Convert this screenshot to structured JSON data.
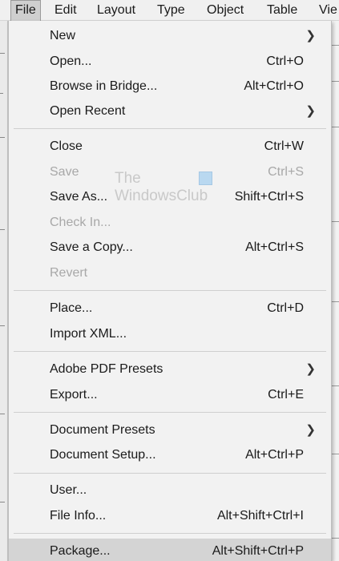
{
  "menubar": {
    "items": [
      "File",
      "Edit",
      "Layout",
      "Type",
      "Object",
      "Table",
      "Vie"
    ]
  },
  "watermark": {
    "line1": "The",
    "line2": "WindowsClub"
  },
  "menu": {
    "items": [
      {
        "label": "New",
        "shortcut": "",
        "submenu": true,
        "disabled": false
      },
      {
        "label": "Open...",
        "shortcut": "Ctrl+O",
        "submenu": false,
        "disabled": false
      },
      {
        "label": "Browse in Bridge...",
        "shortcut": "Alt+Ctrl+O",
        "submenu": false,
        "disabled": false
      },
      {
        "label": "Open Recent",
        "shortcut": "",
        "submenu": true,
        "disabled": false
      },
      {
        "label": "Close",
        "shortcut": "Ctrl+W",
        "submenu": false,
        "disabled": false
      },
      {
        "label": "Save",
        "shortcut": "Ctrl+S",
        "submenu": false,
        "disabled": true
      },
      {
        "label": "Save As...",
        "shortcut": "Shift+Ctrl+S",
        "submenu": false,
        "disabled": false
      },
      {
        "label": "Check In...",
        "shortcut": "",
        "submenu": false,
        "disabled": true
      },
      {
        "label": "Save a Copy...",
        "shortcut": "Alt+Ctrl+S",
        "submenu": false,
        "disabled": false
      },
      {
        "label": "Revert",
        "shortcut": "",
        "submenu": false,
        "disabled": true
      },
      {
        "label": "Place...",
        "shortcut": "Ctrl+D",
        "submenu": false,
        "disabled": false
      },
      {
        "label": "Import XML...",
        "shortcut": "",
        "submenu": false,
        "disabled": false
      },
      {
        "label": "Adobe PDF Presets",
        "shortcut": "",
        "submenu": true,
        "disabled": false
      },
      {
        "label": "Export...",
        "shortcut": "Ctrl+E",
        "submenu": false,
        "disabled": false
      },
      {
        "label": "Document Presets",
        "shortcut": "",
        "submenu": true,
        "disabled": false
      },
      {
        "label": "Document Setup...",
        "shortcut": "Alt+Ctrl+P",
        "submenu": false,
        "disabled": false
      },
      {
        "label": "User...",
        "shortcut": "",
        "submenu": false,
        "disabled": false
      },
      {
        "label": "File Info...",
        "shortcut": "Alt+Shift+Ctrl+I",
        "submenu": false,
        "disabled": false
      },
      {
        "label": "Package...",
        "shortcut": "Alt+Shift+Ctrl+P",
        "submenu": false,
        "disabled": false
      }
    ]
  },
  "icons": {
    "submenu_arrow": "chevron-right-icon",
    "watermark_logo": "windowsclub-logo-icon"
  }
}
